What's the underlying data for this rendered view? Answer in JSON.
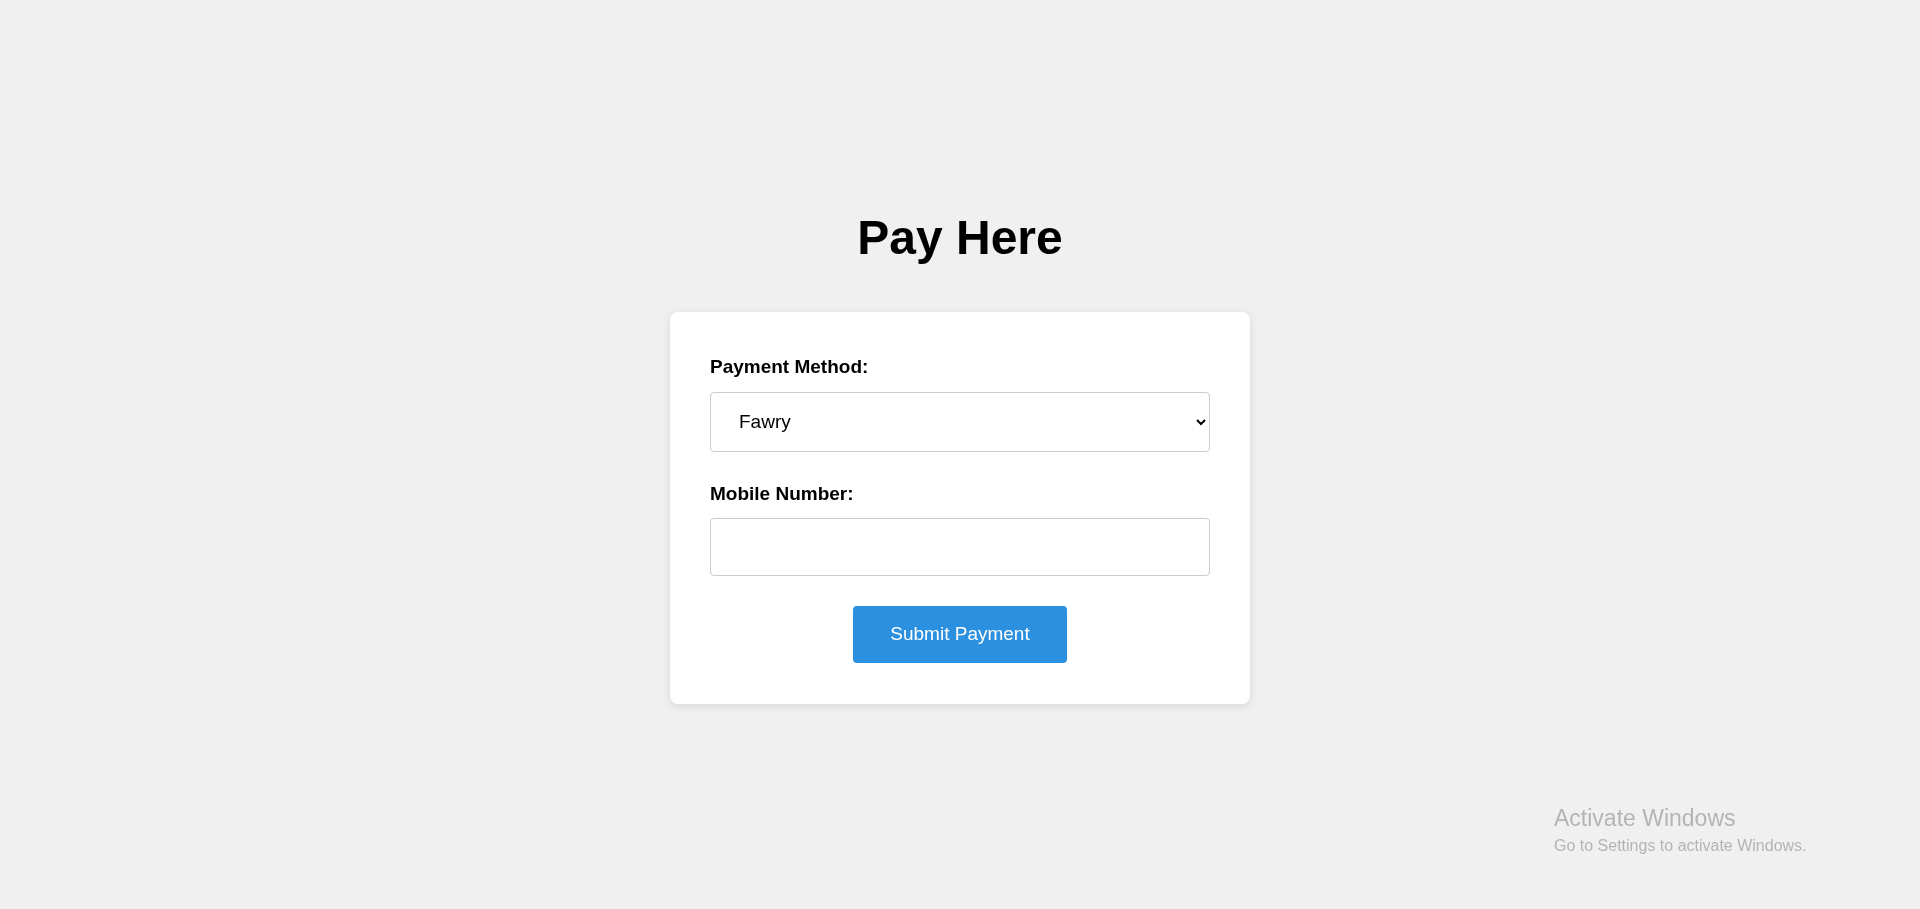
{
  "title": "Pay Here",
  "form": {
    "fields": [
      {
        "kind": "select",
        "label": "Payment Method:",
        "value": "Fawry"
      },
      {
        "kind": "text",
        "label": "Mobile Number:"
      }
    ],
    "submit": "Submit Payment"
  },
  "os_notice": {
    "title": "Activate Windows",
    "text": "Go to Settings to activate Windows."
  }
}
